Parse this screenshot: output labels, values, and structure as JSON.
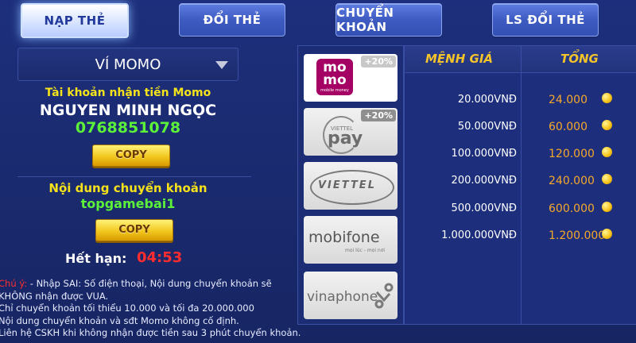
{
  "tabs": [
    {
      "label": "NẠP THẺ",
      "active": true
    },
    {
      "label": "ĐỔI THẺ",
      "active": false
    },
    {
      "label": "CHUYỂN KHOẢN",
      "active": false
    },
    {
      "label": "LS ĐỔI THẺ",
      "active": false
    }
  ],
  "wallet": {
    "selected": "VÍ MOMO",
    "account_label": "Tài khoản nhận tiền Momo",
    "account_name": "NGUYEN MINH NGỌC",
    "phone": "0768851078",
    "copy_label": "COPY",
    "content_label": "Nội dung chuyển khoản",
    "content_value": "topgamebai1",
    "expire_label": "Hết hạn:",
    "expire_time": "04:53"
  },
  "notes": {
    "warning_prefix": "Chú ý:",
    "lines": [
      " - Nhập SAI: Số điện thoại, Nội dung chuyển khoản sẽ",
      "KHÔNG nhận được VUA.",
      "Chỉ chuyển khoản tối thiểu 10.000 và tối đa 20.000.000",
      "Nội dung chuyển khoản và sđt Momo không cố định.",
      "Liên hệ CSKH khi không nhận được tiền sau 3 phút chuyển khoản."
    ]
  },
  "carriers": [
    {
      "name": "momo",
      "logo_top": "mo",
      "logo_bottom": "mo",
      "sub": "mobile money",
      "bonus": "+20%",
      "selected": true
    },
    {
      "name": "viettel pay",
      "logo_small": "VIETTEL",
      "logo_main": "pay",
      "bonus": "+20%"
    },
    {
      "name": "viettel",
      "logo": "VIETTEL"
    },
    {
      "name": "mobifone",
      "logo": "mobifone",
      "tagline": "mọi lúc - mọi nơi"
    },
    {
      "name": "vinaphone",
      "logo": "vinaphone"
    }
  ],
  "table": {
    "col_value": "MỆNH GIÁ",
    "col_total": "TỔNG",
    "rows": [
      {
        "value": "20.000VNĐ",
        "total": "24.000"
      },
      {
        "value": "50.000VNĐ",
        "total": "60.000"
      },
      {
        "value": "100.000VNĐ",
        "total": "120.000"
      },
      {
        "value": "200.000VNĐ",
        "total": "240.000"
      },
      {
        "value": "500.000VNĐ",
        "total": "600.000"
      },
      {
        "value": "1.000.000VNĐ",
        "total": "1.200.000"
      }
    ]
  },
  "colors": {
    "accent_yellow": "#f6e21a",
    "green": "#5df23a",
    "warn_red": "#ff2d2d",
    "momo_pink": "#a50064"
  }
}
